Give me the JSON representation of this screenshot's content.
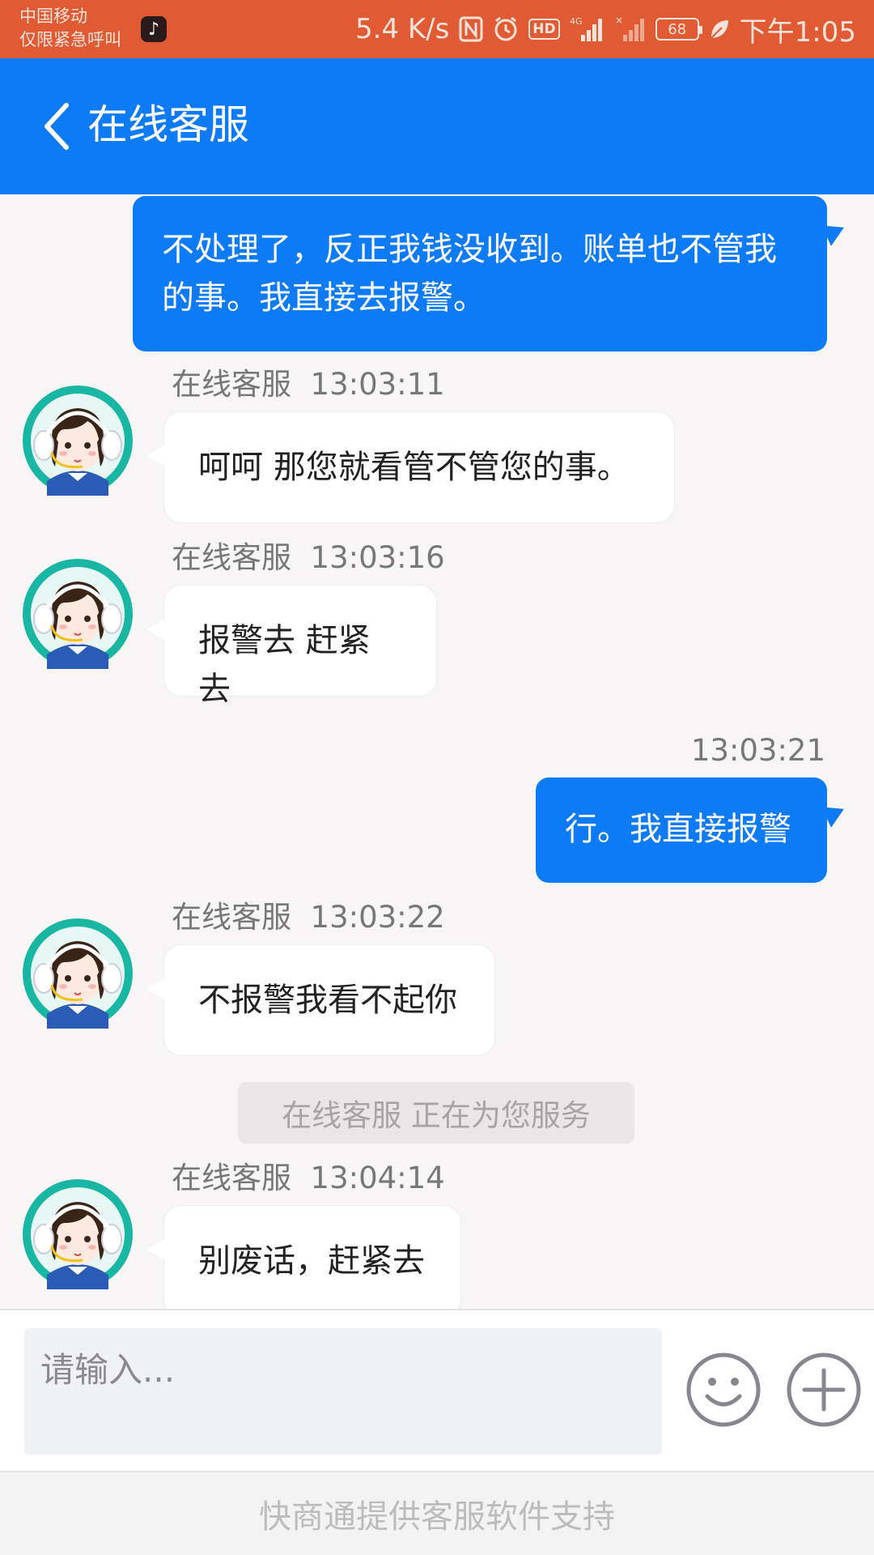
{
  "status_bar": {
    "carrier_line1": "中国移动",
    "carrier_line2": "仅限紧急呼叫",
    "network_speed": "5.4 K/s",
    "battery": "68",
    "time": "下午1:05",
    "icons": [
      "tiktok-icon",
      "nfc-icon",
      "alarm-icon",
      "hd-icon",
      "4g-signal-icon",
      "no-signal-icon",
      "battery-icon",
      "leaf-icon"
    ]
  },
  "header": {
    "back_icon": "chevron-left-icon",
    "title": "在线客服"
  },
  "messages": [
    {
      "side": "out",
      "time": "",
      "text": "不处理了，反正我钱没收到。账单也不管我的事。我直接去报警。"
    },
    {
      "side": "in",
      "sender": "在线客服",
      "time": "13:03:11",
      "text": "呵呵 那您就看管不管您的事。"
    },
    {
      "side": "in",
      "sender": "在线客服",
      "time": "13:03:16",
      "text": "报警去 赶紧去"
    },
    {
      "side": "out",
      "time": "13:03:21",
      "text": "行。我直接报警"
    },
    {
      "side": "in",
      "sender": "在线客服",
      "time": "13:03:22",
      "text": "不报警我看不起你"
    },
    {
      "side": "in",
      "sender": "在线客服",
      "time": "13:04:14",
      "text": "别废话，赶紧去"
    }
  ],
  "system_notice": "在线客服 正在为您服务",
  "input": {
    "placeholder": "请输入...",
    "emoji_icon": "smiley-icon",
    "add_icon": "plus-circle-icon"
  },
  "footer_text": "快商通提供客服软件支持",
  "colors": {
    "status_bar": "#e05a33",
    "header": "#0e7bf6",
    "outgoing_bubble": "#0e7bf6",
    "avatar_ring": "#1ab6a4"
  }
}
